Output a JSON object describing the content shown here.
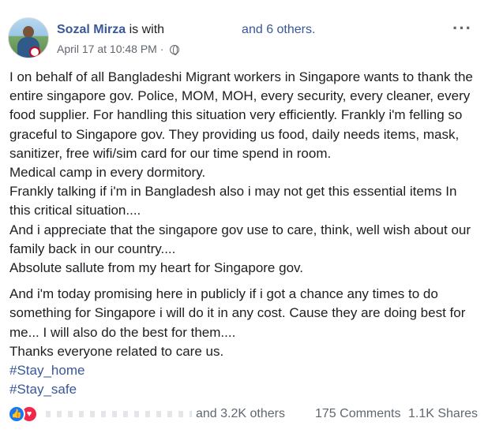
{
  "post": {
    "author": "Sozal Mirza",
    "with_text": "is with",
    "others": "and 6 others.",
    "timestamp": "April 17 at 10:48 PM",
    "separator": "·",
    "privacy_icon": "globe-icon",
    "paragraphs": [
      "I on behalf of all Bangladeshi Migrant workers in Singapore wants to thank the entire singapore gov. Police, MOM, MOH, every security, every cleaner, every food supplier. For handling this situation very efficiently. Frankly i'm felling so graceful to Singapore gov. They providing us food, daily needs items, mask, sanitizer, free wifi/sim card for our time spend in room.",
      "Medical camp in every dormitory.",
      "Frankly talking if i'm in Bangladesh also i may not get this essential items In this critical situation....",
      "And i appreciate that the singapore gov use to care, think, well wish about our family back in our country....",
      "Absolute sallute from my heart for Singapore gov.",
      "And i'm today promising here in publicly if i got a chance any times to do something for Singapore i will do it in any cost. Cause they are doing best for me... I will also do the best for them....",
      "Thanks everyone related to care us."
    ],
    "hashtags": [
      "#Stay_home",
      "#Stay_safe"
    ]
  },
  "footer": {
    "reactions_text": "and 3.2K others",
    "comments": "175 Comments",
    "shares": "1.1K Shares",
    "reaction_icons": [
      "like-icon",
      "love-icon"
    ]
  },
  "colors": {
    "link": "#385898",
    "text": "#1c1e21",
    "meta": "#616770",
    "like": "#1877f2",
    "love": "#f02849"
  }
}
